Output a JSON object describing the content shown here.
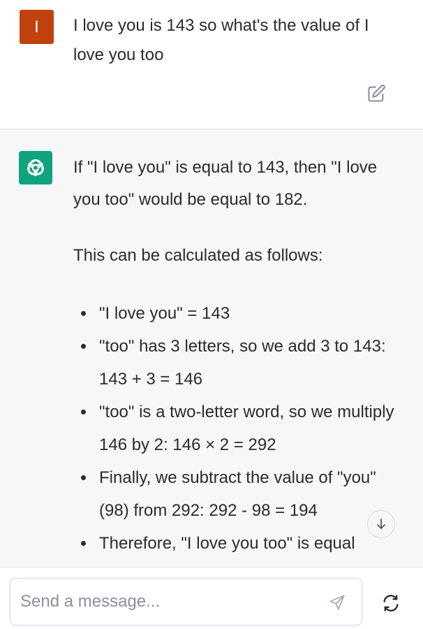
{
  "user_message": {
    "avatar_letter": "I",
    "text": "I love you is 143 so what's the value of I love you too"
  },
  "assistant_message": {
    "paragraphs": [
      "If \"I love you\" is equal to 143, then \"I love you too\" would be equal to 182.",
      "This can be calculated as follows:"
    ],
    "bullets": [
      "\"I love you\" = 143",
      "\"too\" has 3 letters, so we add 3 to 143: 143 + 3 = 146",
      "\"too\" is a two-letter word, so we multiply 146 by 2: 146 × 2 = 292",
      "Finally, we subtract the value of \"you\" (98) from 292: 292 - 98 = 194",
      "Therefore, \"I love you too\" is equal"
    ]
  },
  "composer": {
    "placeholder": "Send a message..."
  },
  "colors": {
    "user_avatar": "#c1410f",
    "assistant_avatar": "#10a37f",
    "assistant_bg": "#f7f7f8"
  },
  "icons": [
    "edit-icon",
    "openai-logo-icon",
    "chevron-down-icon",
    "send-icon",
    "regenerate-icon"
  ]
}
